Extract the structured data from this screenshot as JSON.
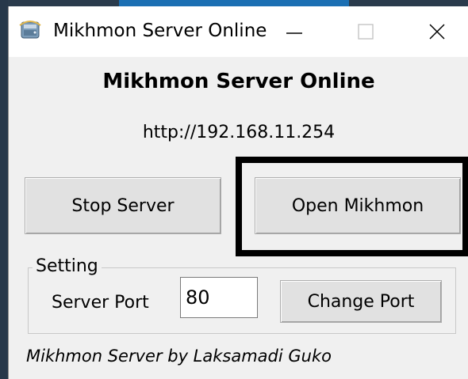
{
  "window": {
    "title": "Mikhmon Server Online",
    "app_icon": "mikhmon-app-icon",
    "controls": {
      "minimize": "minimize-icon",
      "maximize": "maximize-icon",
      "close": "close-icon"
    }
  },
  "main": {
    "heading": "Mikhmon Server Online",
    "url": "http://192.168.11.254",
    "stop_button_label": "Stop Server",
    "open_button_label": "Open Mikhmon"
  },
  "setting": {
    "group_label": "Setting",
    "port_label": "Server Port",
    "port_value": "80",
    "change_port_label": "Change Port"
  },
  "footer": {
    "credit": "Mikhmon Server by  Laksamadi Guko"
  },
  "colors": {
    "window_bg": "#f0f0f0",
    "titlebar_bg": "#ffffff",
    "button_bg": "#e1e1e1",
    "highlight_border": "#000000"
  }
}
